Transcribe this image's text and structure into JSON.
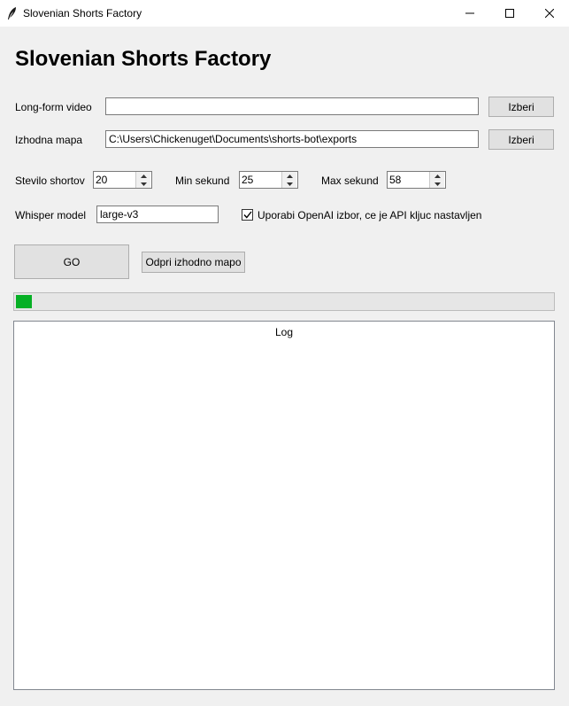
{
  "window": {
    "title": "Slovenian Shorts Factory",
    "icon": "feather-icon"
  },
  "header": {
    "title": "Slovenian Shorts Factory"
  },
  "video": {
    "label": "Long-form video",
    "value": "",
    "browse_label": "Izberi"
  },
  "output": {
    "label": "Izhodna mapa",
    "value": "C:\\Users\\Chickenuget\\Documents\\shorts-bot\\exports",
    "browse_label": "Izberi"
  },
  "settings": {
    "count_label": "Stevilo shortov",
    "count_value": "20",
    "min_label": "Min sekund",
    "min_value": "25",
    "max_label": "Max sekund",
    "max_value": "58"
  },
  "whisper": {
    "label": "Whisper model",
    "value": "large-v3",
    "openai_checked": true,
    "openai_label": "Uporabi OpenAI izbor, ce je API kljuc nastavljen"
  },
  "actions": {
    "go_label": "GO",
    "open_folder_label": "Odpri izhodno mapo"
  },
  "progress": {
    "value": 0.03,
    "color": "#06b025"
  },
  "log": {
    "title": "Log",
    "content": ""
  }
}
